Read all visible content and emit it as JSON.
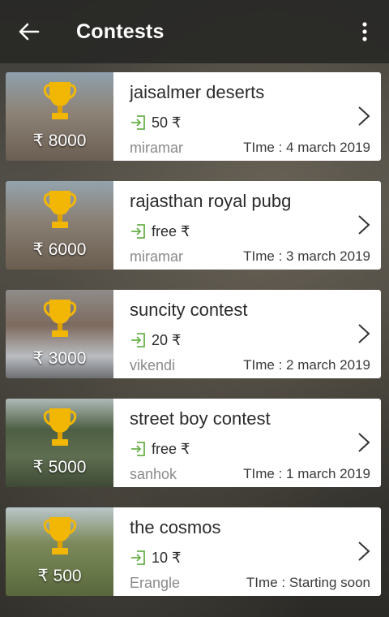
{
  "app_bar": {
    "title": "Contests",
    "back_icon": "arrow-left-icon",
    "menu_icon": "more-vert-icon"
  },
  "colors": {
    "app_bar": "#282826",
    "card": "#ffffff",
    "enter_icon": "#6ab04c",
    "trophy": "#f2b705"
  },
  "contests": [
    {
      "prize": "₹ 8000",
      "name": "jaisalmer deserts",
      "fee": "50 ₹",
      "map": "miramar",
      "time": "TIme : 4 march 2019",
      "thumb_style": "city"
    },
    {
      "prize": "₹ 6000",
      "name": "rajasthan royal pubg",
      "fee": "free ₹",
      "map": "miramar",
      "time": "TIme : 3 march 2019",
      "thumb_style": "city"
    },
    {
      "prize": "₹ 3000",
      "name": "suncity contest",
      "fee": "20 ₹",
      "map": "vikendi",
      "time": "TIme : 2 march 2019",
      "thumb_style": "snow"
    },
    {
      "prize": "₹ 5000",
      "name": "street boy contest",
      "fee": "free ₹",
      "map": "sanhok",
      "time": "TIme : 1 march 2019",
      "thumb_style": "jungle"
    },
    {
      "prize": "₹ 500",
      "name": "the cosmos",
      "fee": "10 ₹",
      "map": "Erangle",
      "time": "TIme : Starting soon",
      "thumb_style": "field"
    }
  ]
}
